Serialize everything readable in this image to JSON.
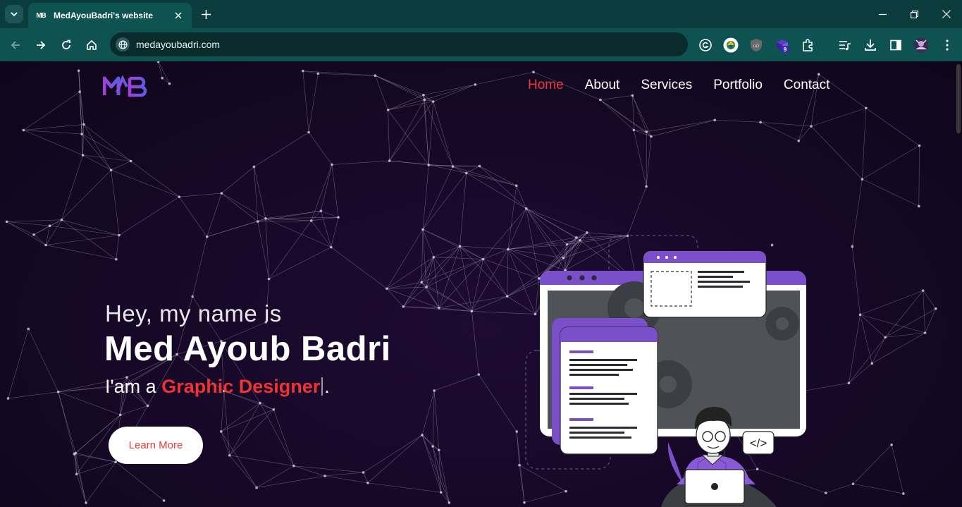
{
  "browser": {
    "tab_title": "MedAyouBadri's website",
    "favicon_text": "MB",
    "url": "medayoubadri.com",
    "extension_badge": "9"
  },
  "site": {
    "logo_text": "MB",
    "nav": [
      {
        "label": "Home",
        "active": true
      },
      {
        "label": "About",
        "active": false
      },
      {
        "label": "Services",
        "active": false
      },
      {
        "label": "Portfolio",
        "active": false
      },
      {
        "label": "Contact",
        "active": false
      }
    ],
    "hero": {
      "intro": "Hey, my name is",
      "name": "Med Ayoub Badri",
      "role_prefix": "I'am a ",
      "role_highlight": "Graphic Designer",
      "role_suffix": ".",
      "cta": "Learn More"
    },
    "illustration": {
      "code_tag": "</>"
    }
  },
  "colors": {
    "accent": "#ec3b3b",
    "brand_purple": "#7b4fc9",
    "chrome_teal": "#0e5252"
  }
}
